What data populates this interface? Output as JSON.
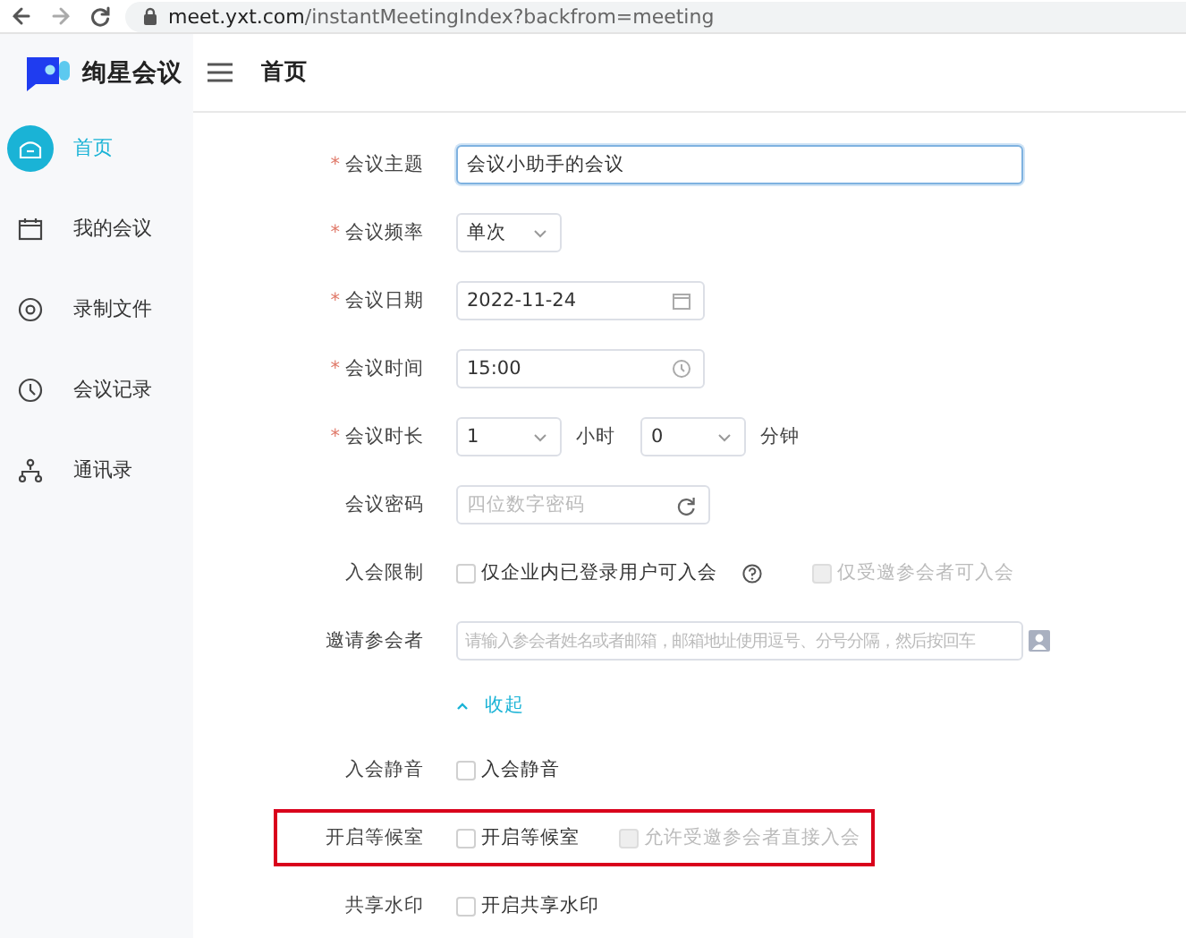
{
  "browser": {
    "url_host": "meet.yxt.com",
    "url_path": "/instantMeetingIndex?backfrom=meeting"
  },
  "header": {
    "logo_text": "绚星会议",
    "page_title": "首页"
  },
  "sidebar": {
    "items": [
      {
        "label": "首页",
        "kind": "home",
        "selected": true
      },
      {
        "label": "我的会议",
        "kind": "calendar",
        "selected": false
      },
      {
        "label": "录制文件",
        "kind": "disc",
        "selected": false
      },
      {
        "label": "会议记录",
        "kind": "clock",
        "selected": false
      },
      {
        "label": "通讯录",
        "kind": "contacts",
        "selected": false
      }
    ]
  },
  "form": {
    "rows": [
      {
        "label": "会议主题",
        "required_mark": "*",
        "kind": "text",
        "value": "会议小助手的会议",
        "focused": true
      },
      {
        "label": "会议频率",
        "required_mark": "*",
        "kind": "select",
        "value": "单次"
      },
      {
        "label": "会议日期",
        "required_mark": "*",
        "kind": "date",
        "value": "2022-11-24"
      },
      {
        "label": "会议时间",
        "required_mark": "*",
        "kind": "time",
        "value": "15:00"
      },
      {
        "label": "会议时长",
        "required_mark": "*",
        "kind": "duration",
        "hours": "1",
        "hours_unit": "小时",
        "minutes": "0",
        "minutes_unit": "分钟"
      },
      {
        "label": "会议密码",
        "kind": "password",
        "placeholder": "四位数字密码"
      },
      {
        "label": "入会限制",
        "kind": "checkboxes",
        "options": [
          {
            "label": "仅企业内已登录用户可入会",
            "checked": false,
            "disabled": false,
            "help": true
          },
          {
            "label": "仅受邀参会者可入会",
            "checked": false,
            "disabled": true
          }
        ]
      },
      {
        "label": "邀请参会者",
        "kind": "invite",
        "placeholder": "请输入参会者姓名或者邮箱，邮箱地址使用逗号、分号分隔，然后按回车"
      },
      {
        "kind": "collapse",
        "text": "收起"
      },
      {
        "label": "入会静音",
        "kind": "checkboxes",
        "options": [
          {
            "label": "入会静音",
            "checked": false,
            "disabled": false
          }
        ]
      },
      {
        "label": "开启等候室",
        "kind": "checkboxes",
        "highlighted": true,
        "options": [
          {
            "label": "开启等候室",
            "checked": false,
            "disabled": false
          },
          {
            "label": "允许受邀参会者直接入会",
            "checked": false,
            "disabled": true
          }
        ]
      },
      {
        "label": "共享水印",
        "kind": "checkboxes",
        "options": [
          {
            "label": "开启共享水印",
            "checked": false,
            "disabled": false
          }
        ]
      }
    ]
  }
}
